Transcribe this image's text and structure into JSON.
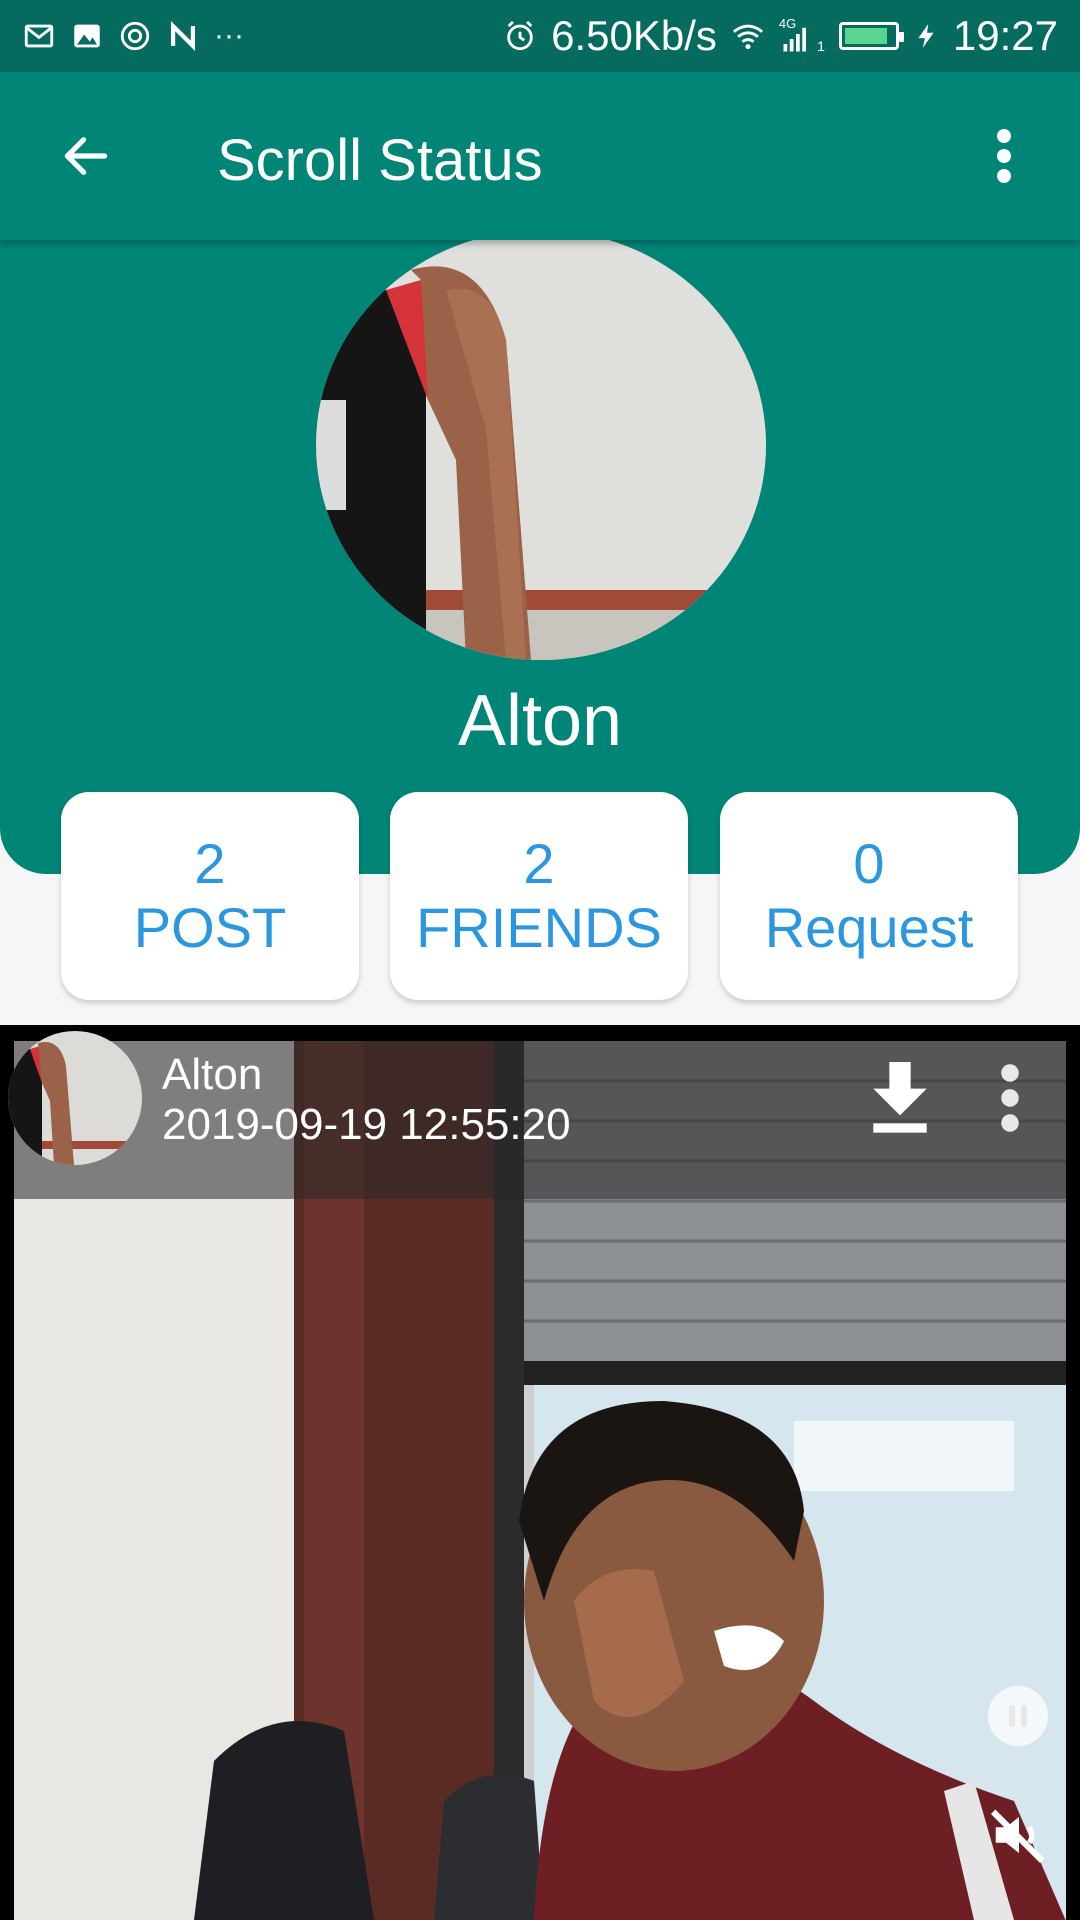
{
  "status_bar": {
    "net_speed": "6.50Kb/s",
    "network_type": "4G",
    "sim_slot": "1",
    "time": "19:27",
    "overflow_glyph": "···",
    "icons": [
      "gmail-icon",
      "gallery-icon",
      "sync-icon",
      "nfc-icon",
      "alarm-icon",
      "wifi-icon",
      "signal-icon",
      "battery-icon",
      "charging-icon"
    ],
    "battery_level": 0.9
  },
  "app_bar": {
    "title": "Scroll Status",
    "back_icon": "arrow-back-icon",
    "menu_icon": "more-vert-icon"
  },
  "profile": {
    "name": "Alton"
  },
  "stats": {
    "post": {
      "count": "2",
      "label": "POST"
    },
    "friends": {
      "count": "2",
      "label": "FRIENDS"
    },
    "request": {
      "count": "0",
      "label": "Request"
    }
  },
  "post": {
    "author": "Alton",
    "timestamp": "2019-09-19 12:55:20",
    "download_icon": "download-icon",
    "menu_icon": "more-vert-icon",
    "pause_icon": "pause-icon",
    "mute_icon": "volume-off-icon"
  },
  "colors": {
    "primary": "#008577",
    "primary_dark": "#056b5f",
    "accent_text": "#2a97e0"
  }
}
